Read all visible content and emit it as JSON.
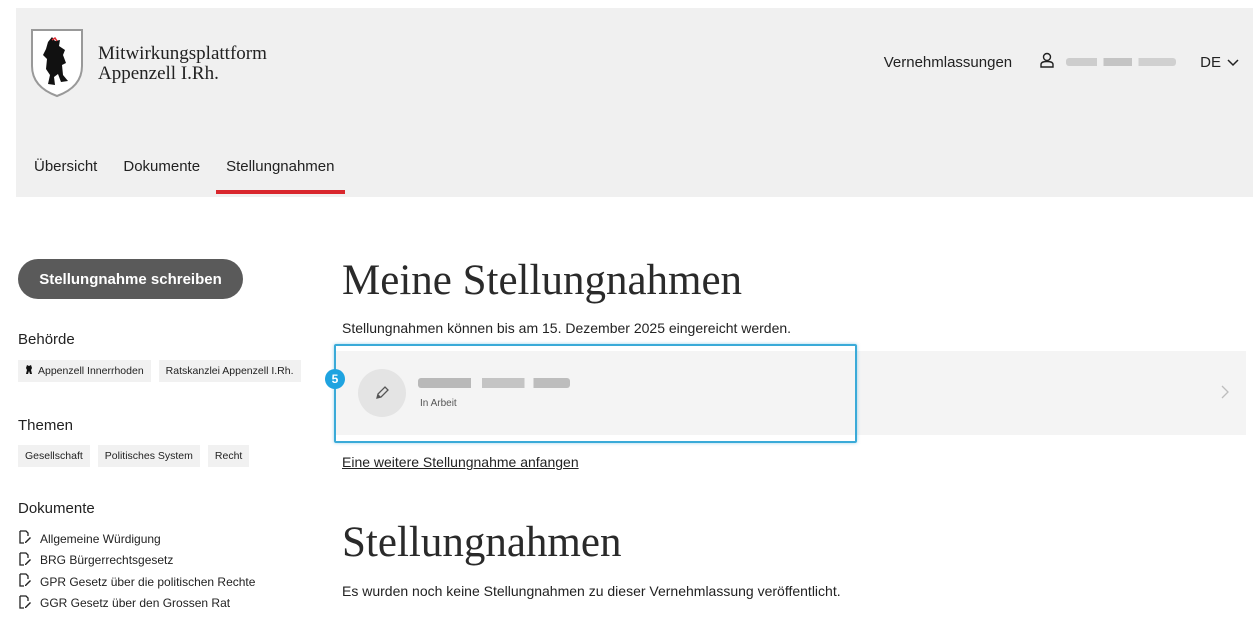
{
  "header": {
    "brand_line1": "Mitwirkungsplattform",
    "brand_line2": "Appenzell I.Rh.",
    "nav_link": "Vernehmlassungen",
    "lang": "DE",
    "tabs": [
      {
        "label": "Übersicht"
      },
      {
        "label": "Dokumente"
      },
      {
        "label": "Stellungnahmen"
      }
    ]
  },
  "sidebar": {
    "write_button": "Stellungnahme schreiben",
    "authority_heading": "Behörde",
    "authorities": [
      "Appenzell Innerrhoden",
      "Ratskanzlei Appenzell I.Rh."
    ],
    "topics_heading": "Themen",
    "topics": [
      "Gesellschaft",
      "Politisches System",
      "Recht"
    ],
    "documents_heading": "Dokumente",
    "documents": [
      "Allgemeine Würdigung",
      "BRG Bürgerrechtsgesetz",
      "GPR Gesetz über die politischen Rechte",
      "GGR Gesetz über den Grossen Rat"
    ]
  },
  "main": {
    "my_title": "Meine Stellungnahmen",
    "deadline_text": "Stellungnahmen können bis am 15. Dezember 2025 eingereicht werden.",
    "entry_status": "In Arbeit",
    "highlight_badge": "5",
    "another_link": "Eine weitere Stellungnahme anfangen",
    "public_title": "Stellungnahmen",
    "public_empty": "Es wurden noch keine Stellungnahmen zu dieser Vernehmlassung veröffentlicht."
  },
  "colors": {
    "accent": "#d9272d",
    "header_bg": "#f0f0f0",
    "button_bg": "#5a5a5a",
    "highlight": "#3aaad8"
  }
}
